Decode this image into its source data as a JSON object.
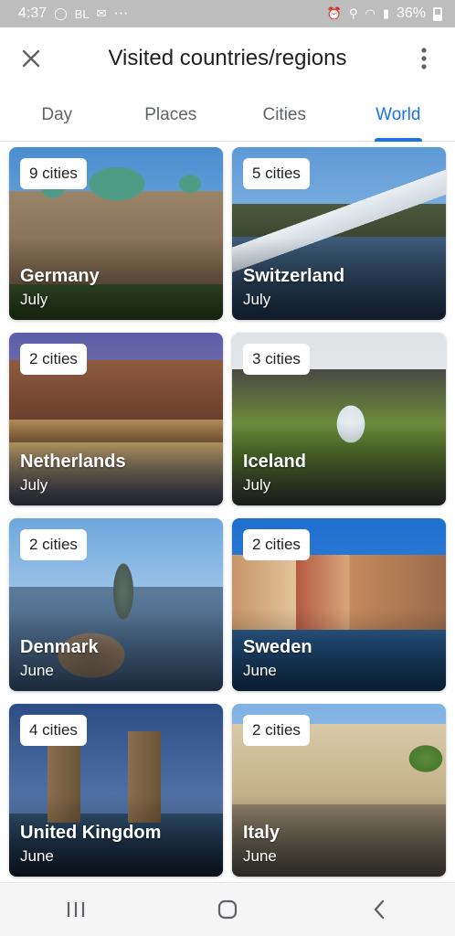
{
  "status_bar": {
    "time": "4:37",
    "left_extra": "BL",
    "dots": "···",
    "battery": "36%"
  },
  "app_bar": {
    "title": "Visited countries/regions"
  },
  "tabs": [
    {
      "label": "Day"
    },
    {
      "label": "Places"
    },
    {
      "label": "Cities"
    },
    {
      "label": "World"
    }
  ],
  "active_tab": "World",
  "cards": [
    {
      "country": "Germany",
      "month": "July",
      "cities": "9 cities"
    },
    {
      "country": "Switzerland",
      "month": "July",
      "cities": "5 cities"
    },
    {
      "country": "Netherlands",
      "month": "July",
      "cities": "2 cities"
    },
    {
      "country": "Iceland",
      "month": "July",
      "cities": "3 cities"
    },
    {
      "country": "Denmark",
      "month": "June",
      "cities": "2 cities"
    },
    {
      "country": "Sweden",
      "month": "June",
      "cities": "2 cities"
    },
    {
      "country": "United Kingdom",
      "month": "June",
      "cities": "4 cities"
    },
    {
      "country": "Italy",
      "month": "June",
      "cities": "2 cities"
    }
  ],
  "colors": {
    "accent": "#1a73e8",
    "status_bar": "#bdbdbd"
  }
}
